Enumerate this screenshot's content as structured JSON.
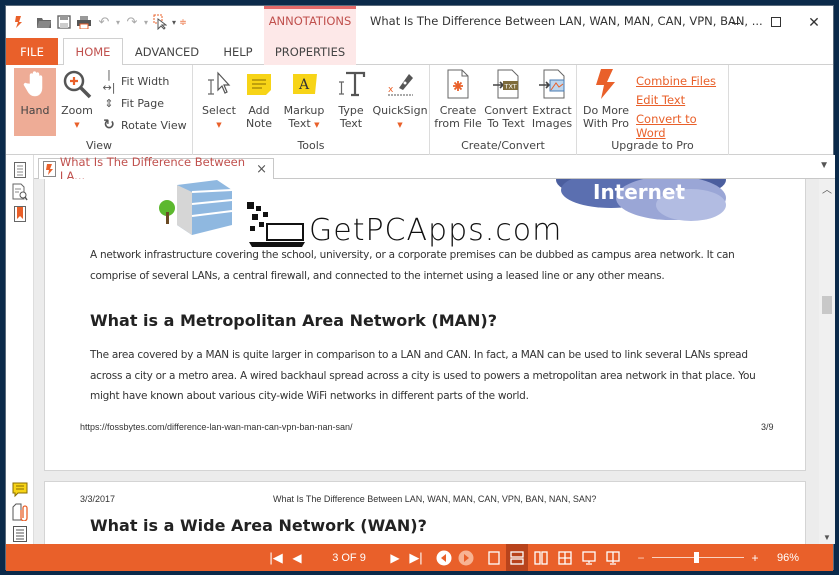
{
  "titlebar": {
    "context_tab_group": "ANNOTATIONS",
    "document_title": "What Is The Difference Between LAN, WAN, MAN, CAN, VPN, BAN, ...",
    "minimize_icon": "minimize-icon",
    "maximize_icon": "maximize-icon",
    "close_icon": "close-icon",
    "quick_access": [
      "app-logo-icon",
      "open-folder-icon",
      "save-icon",
      "print-icon",
      "undo-icon",
      "redo-icon",
      "select-tool-icon",
      "customize-icon"
    ]
  },
  "tabs": {
    "file": "FILE",
    "home": "HOME",
    "advanced": "ADVANCED",
    "help": "HELP",
    "properties": "PROPERTIES"
  },
  "ribbon": {
    "view": {
      "label": "View",
      "hand": "Hand",
      "zoom": "Zoom",
      "fit_width": "Fit Width",
      "fit_page": "Fit Page",
      "rotate_view": "Rotate View"
    },
    "tools": {
      "label": "Tools",
      "select": "Select",
      "add_note_1": "Add",
      "add_note_2": "Note",
      "markup_1": "Markup",
      "markup_2": "Text",
      "type_1": "Type",
      "type_2": "Text",
      "quicksign": "QuickSign"
    },
    "create": {
      "label": "Create/Convert",
      "create_1": "Create",
      "create_2": "from File",
      "convert_1": "Convert",
      "convert_2": "To Text",
      "extract_1": "Extract",
      "extract_2": "Images"
    },
    "upgrade": {
      "label": "Upgrade to Pro",
      "do_more_1": "Do More",
      "do_more_2": "With Pro",
      "links": [
        "Combine Files",
        "Edit Text",
        "Convert to Word"
      ]
    }
  },
  "doc_tab": {
    "title": "What Is The Difference Between LA...",
    "close": "×"
  },
  "page": {
    "logo_text": "GetPCApps.com",
    "cloud_text": "Internet",
    "para1": "A network infrastructure covering the school, university, or a corporate premises can be dubbed as campus area network. It can comprise of several LANs, a central firewall, and connected to the internet using a leased line or any other means.",
    "heading_man": "What is a Metropolitan Area Network (MAN)?",
    "para2": "The area covered by a MAN is quite larger in comparison to a LAN and CAN. In fact, a MAN can be used to link several LANs spread across a city or a metro area. A wired backhaul spread across a city is used to powers a metropolitan area network in that place. You might have known about various city-wide WiFi networks in different parts of the world.",
    "footer_url": "https://fossbytes.com/difference-lan-wan-man-can-vpn-ban-nan-san/",
    "footer_page": "3/9"
  },
  "next_page": {
    "date": "3/3/2017",
    "header_title": "What Is The Difference Between LAN, WAN, MAN, CAN, VPN, BAN, NAN, SAN?",
    "heading_wan": "What is a Wide Area Network (WAN)?"
  },
  "statusbar": {
    "page_indicator": "3 OF 9",
    "zoom_level": "96%",
    "zoom_fraction": 0.48,
    "zoom_minus": "−",
    "zoom_plus": "+"
  },
  "colors": {
    "accent": "#e9602a",
    "context_tab": "#c0504d",
    "hand_selected": "#eeac96"
  }
}
